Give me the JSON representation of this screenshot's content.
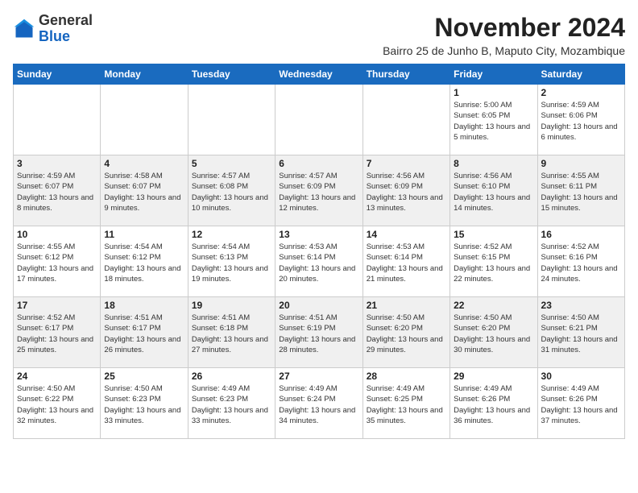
{
  "header": {
    "logo_line1": "General",
    "logo_line2": "Blue",
    "month_year": "November 2024",
    "subtitle": "Bairro 25 de Junho B, Maputo City, Mozambique"
  },
  "days_of_week": [
    "Sunday",
    "Monday",
    "Tuesday",
    "Wednesday",
    "Thursday",
    "Friday",
    "Saturday"
  ],
  "weeks": [
    [
      {
        "day": "",
        "sunrise": "",
        "sunset": "",
        "daylight": ""
      },
      {
        "day": "",
        "sunrise": "",
        "sunset": "",
        "daylight": ""
      },
      {
        "day": "",
        "sunrise": "",
        "sunset": "",
        "daylight": ""
      },
      {
        "day": "",
        "sunrise": "",
        "sunset": "",
        "daylight": ""
      },
      {
        "day": "",
        "sunrise": "",
        "sunset": "",
        "daylight": ""
      },
      {
        "day": "1",
        "sunrise": "Sunrise: 5:00 AM",
        "sunset": "Sunset: 6:05 PM",
        "daylight": "Daylight: 13 hours and 5 minutes."
      },
      {
        "day": "2",
        "sunrise": "Sunrise: 4:59 AM",
        "sunset": "Sunset: 6:06 PM",
        "daylight": "Daylight: 13 hours and 6 minutes."
      }
    ],
    [
      {
        "day": "3",
        "sunrise": "Sunrise: 4:59 AM",
        "sunset": "Sunset: 6:07 PM",
        "daylight": "Daylight: 13 hours and 8 minutes."
      },
      {
        "day": "4",
        "sunrise": "Sunrise: 4:58 AM",
        "sunset": "Sunset: 6:07 PM",
        "daylight": "Daylight: 13 hours and 9 minutes."
      },
      {
        "day": "5",
        "sunrise": "Sunrise: 4:57 AM",
        "sunset": "Sunset: 6:08 PM",
        "daylight": "Daylight: 13 hours and 10 minutes."
      },
      {
        "day": "6",
        "sunrise": "Sunrise: 4:57 AM",
        "sunset": "Sunset: 6:09 PM",
        "daylight": "Daylight: 13 hours and 12 minutes."
      },
      {
        "day": "7",
        "sunrise": "Sunrise: 4:56 AM",
        "sunset": "Sunset: 6:09 PM",
        "daylight": "Daylight: 13 hours and 13 minutes."
      },
      {
        "day": "8",
        "sunrise": "Sunrise: 4:56 AM",
        "sunset": "Sunset: 6:10 PM",
        "daylight": "Daylight: 13 hours and 14 minutes."
      },
      {
        "day": "9",
        "sunrise": "Sunrise: 4:55 AM",
        "sunset": "Sunset: 6:11 PM",
        "daylight": "Daylight: 13 hours and 15 minutes."
      }
    ],
    [
      {
        "day": "10",
        "sunrise": "Sunrise: 4:55 AM",
        "sunset": "Sunset: 6:12 PM",
        "daylight": "Daylight: 13 hours and 17 minutes."
      },
      {
        "day": "11",
        "sunrise": "Sunrise: 4:54 AM",
        "sunset": "Sunset: 6:12 PM",
        "daylight": "Daylight: 13 hours and 18 minutes."
      },
      {
        "day": "12",
        "sunrise": "Sunrise: 4:54 AM",
        "sunset": "Sunset: 6:13 PM",
        "daylight": "Daylight: 13 hours and 19 minutes."
      },
      {
        "day": "13",
        "sunrise": "Sunrise: 4:53 AM",
        "sunset": "Sunset: 6:14 PM",
        "daylight": "Daylight: 13 hours and 20 minutes."
      },
      {
        "day": "14",
        "sunrise": "Sunrise: 4:53 AM",
        "sunset": "Sunset: 6:14 PM",
        "daylight": "Daylight: 13 hours and 21 minutes."
      },
      {
        "day": "15",
        "sunrise": "Sunrise: 4:52 AM",
        "sunset": "Sunset: 6:15 PM",
        "daylight": "Daylight: 13 hours and 22 minutes."
      },
      {
        "day": "16",
        "sunrise": "Sunrise: 4:52 AM",
        "sunset": "Sunset: 6:16 PM",
        "daylight": "Daylight: 13 hours and 24 minutes."
      }
    ],
    [
      {
        "day": "17",
        "sunrise": "Sunrise: 4:52 AM",
        "sunset": "Sunset: 6:17 PM",
        "daylight": "Daylight: 13 hours and 25 minutes."
      },
      {
        "day": "18",
        "sunrise": "Sunrise: 4:51 AM",
        "sunset": "Sunset: 6:17 PM",
        "daylight": "Daylight: 13 hours and 26 minutes."
      },
      {
        "day": "19",
        "sunrise": "Sunrise: 4:51 AM",
        "sunset": "Sunset: 6:18 PM",
        "daylight": "Daylight: 13 hours and 27 minutes."
      },
      {
        "day": "20",
        "sunrise": "Sunrise: 4:51 AM",
        "sunset": "Sunset: 6:19 PM",
        "daylight": "Daylight: 13 hours and 28 minutes."
      },
      {
        "day": "21",
        "sunrise": "Sunrise: 4:50 AM",
        "sunset": "Sunset: 6:20 PM",
        "daylight": "Daylight: 13 hours and 29 minutes."
      },
      {
        "day": "22",
        "sunrise": "Sunrise: 4:50 AM",
        "sunset": "Sunset: 6:20 PM",
        "daylight": "Daylight: 13 hours and 30 minutes."
      },
      {
        "day": "23",
        "sunrise": "Sunrise: 4:50 AM",
        "sunset": "Sunset: 6:21 PM",
        "daylight": "Daylight: 13 hours and 31 minutes."
      }
    ],
    [
      {
        "day": "24",
        "sunrise": "Sunrise: 4:50 AM",
        "sunset": "Sunset: 6:22 PM",
        "daylight": "Daylight: 13 hours and 32 minutes."
      },
      {
        "day": "25",
        "sunrise": "Sunrise: 4:50 AM",
        "sunset": "Sunset: 6:23 PM",
        "daylight": "Daylight: 13 hours and 33 minutes."
      },
      {
        "day": "26",
        "sunrise": "Sunrise: 4:49 AM",
        "sunset": "Sunset: 6:23 PM",
        "daylight": "Daylight: 13 hours and 33 minutes."
      },
      {
        "day": "27",
        "sunrise": "Sunrise: 4:49 AM",
        "sunset": "Sunset: 6:24 PM",
        "daylight": "Daylight: 13 hours and 34 minutes."
      },
      {
        "day": "28",
        "sunrise": "Sunrise: 4:49 AM",
        "sunset": "Sunset: 6:25 PM",
        "daylight": "Daylight: 13 hours and 35 minutes."
      },
      {
        "day": "29",
        "sunrise": "Sunrise: 4:49 AM",
        "sunset": "Sunset: 6:26 PM",
        "daylight": "Daylight: 13 hours and 36 minutes."
      },
      {
        "day": "30",
        "sunrise": "Sunrise: 4:49 AM",
        "sunset": "Sunset: 6:26 PM",
        "daylight": "Daylight: 13 hours and 37 minutes."
      }
    ]
  ]
}
